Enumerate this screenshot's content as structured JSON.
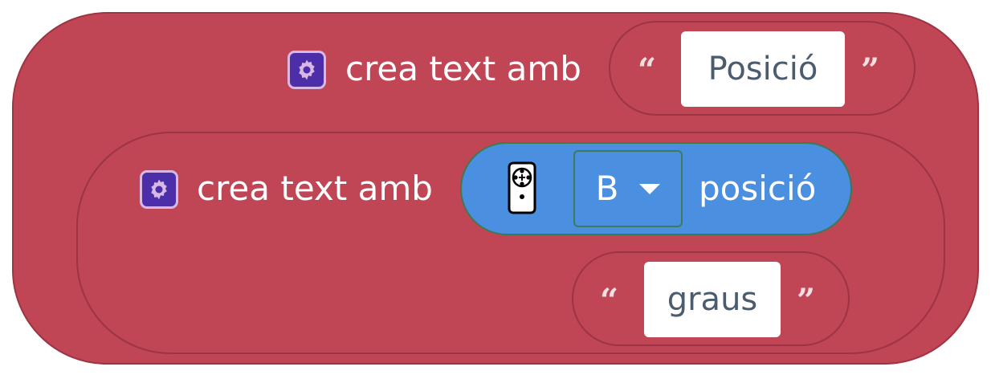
{
  "block_outer": {
    "label": "crea text amb",
    "string_value": "Posició"
  },
  "block_inner": {
    "label": "crea text amb",
    "sensor": {
      "dropdown_value": "B",
      "suffix": "posició"
    },
    "string_value": "graus"
  },
  "quotes": {
    "open": "“",
    "close": "”"
  },
  "colors": {
    "text_block": "#c04655",
    "text_block_border": "#9d3443",
    "sensor_block": "#4a8fe0",
    "icon_bg": "#4c2ea9",
    "icon_border": "#d9b8e6"
  },
  "icons": {
    "extension": "gear-icon",
    "device": "remote-controller-icon"
  }
}
